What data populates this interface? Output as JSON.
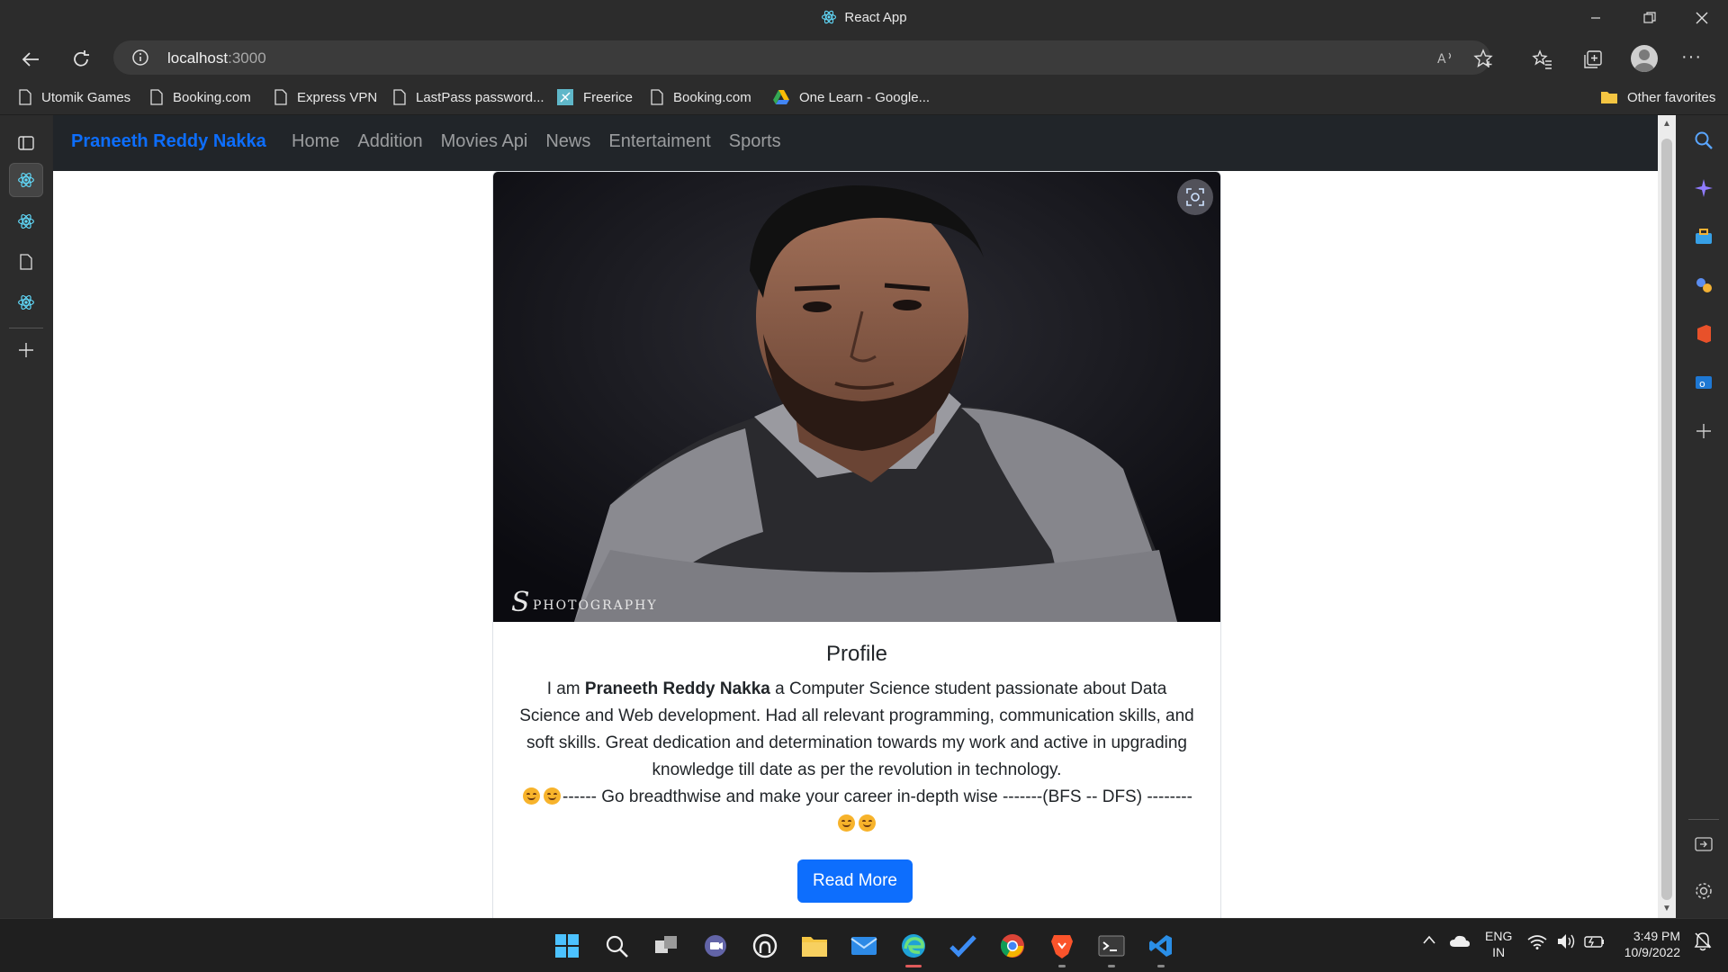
{
  "browser": {
    "window_title": "React App",
    "url_host": "localhost",
    "url_port": ":3000"
  },
  "favorites": [
    {
      "label": "Utomik Games",
      "icon": "page-icon"
    },
    {
      "label": "Booking.com",
      "icon": "page-icon"
    },
    {
      "label": "Express VPN",
      "icon": "page-icon"
    },
    {
      "label": "LastPass password...",
      "icon": "page-icon"
    },
    {
      "label": "Freerice",
      "icon": "freerice-icon"
    },
    {
      "label": "Booking.com",
      "icon": "page-icon"
    },
    {
      "label": "One Learn - Google...",
      "icon": "google-drive-icon"
    }
  ],
  "other_favorites": "Other favorites",
  "site": {
    "brand": "Praneeth Reddy Nakka",
    "nav": [
      "Home",
      "Addition",
      "Movies Api",
      "News",
      "Entertaiment",
      "Sports"
    ],
    "card": {
      "photo_watermark": "PHOTOGRAPHY",
      "title": "Profile",
      "text_prefix": "I am ",
      "text_name": "Praneeth Reddy Nakka",
      "text_body": " a Computer Science student passionate about Data Science and Web development. Had all relevant programming, communication skills, and soft skills. Great dedication and determination towards my work and active in upgrading knowledge till date as per the revolution in technology.",
      "motto": "------ Go breadthwise and make your career in-depth wise -------(BFS -- DFS) --------",
      "button": "Read More"
    }
  },
  "taskbar": {
    "lang_top": "ENG",
    "lang_bottom": "IN",
    "time": "3:49 PM",
    "date": "10/9/2022"
  },
  "colors": {
    "brand": "#0d6efd",
    "navbar_bg": "#212529",
    "button_bg": "#0d6efd"
  }
}
